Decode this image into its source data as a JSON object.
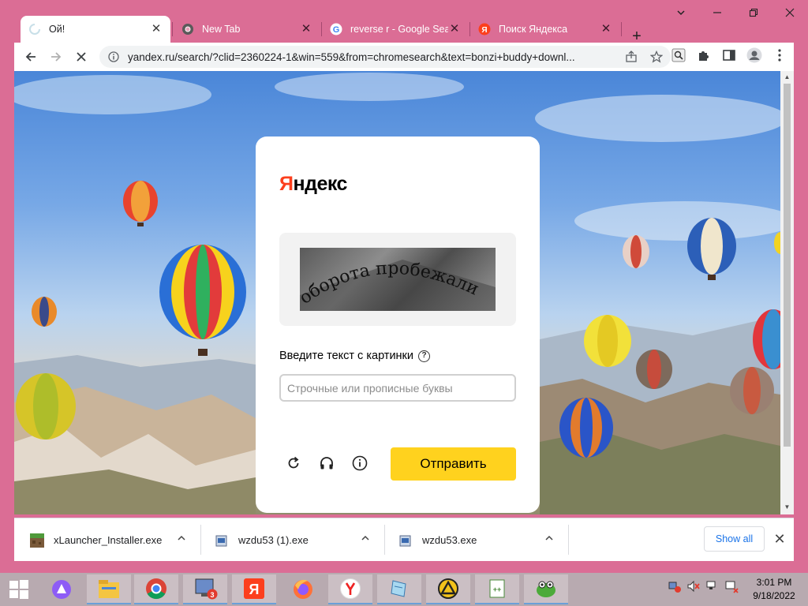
{
  "browser": {
    "tabs": [
      {
        "title": "Ой!",
        "favicon": "loading-spinner-icon",
        "active": true
      },
      {
        "title": "New Tab",
        "favicon": "chrome-icon",
        "active": false
      },
      {
        "title": "reverse r - Google Searc",
        "favicon": "google-icon",
        "active": false
      },
      {
        "title": "Поиск Яндекса",
        "favicon": "yandex-icon",
        "active": false
      }
    ],
    "new_tab_label": "+",
    "url": "yandex.ru/search/?clid=2360224-1&win=559&from=chromesearch&text=bonzi+buddy+downl..."
  },
  "captcha": {
    "logo_first": "Я",
    "logo_rest": "ндекс",
    "captcha_text": "оборота пробежали",
    "prompt_label": "Введите текст с картинки",
    "help_symbol": "?",
    "input_placeholder": "Строчные или прописные буквы",
    "input_value": "",
    "submit_label": "Отправить"
  },
  "downloads": {
    "items": [
      {
        "name": "xLauncher_Installer.exe"
      },
      {
        "name": "wzdu53 (1).exe"
      },
      {
        "name": "wzdu53.exe"
      }
    ],
    "show_all_label": "Show all"
  },
  "taskbar": {
    "badge_count": "3",
    "clock_time": "3:01 PM",
    "clock_date": "9/18/2022"
  },
  "colors": {
    "frame": "#db6d95",
    "yandex_red": "#fc3f1d",
    "submit_yellow": "#ffd21e",
    "link_blue": "#1a73e8"
  }
}
